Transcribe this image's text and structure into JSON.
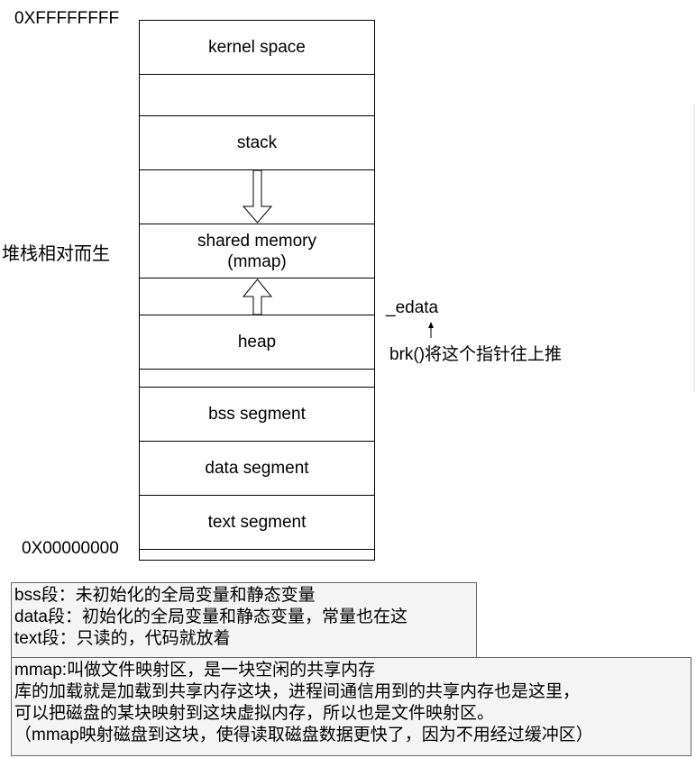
{
  "address_top": "0XFFFFFFFF",
  "address_bottom": "0X00000000",
  "side_label": "堆栈相对而生",
  "segments": {
    "kernel": "kernel space",
    "stack": "stack",
    "shared": "shared memory",
    "shared_sub": "(mmap)",
    "heap": "heap",
    "bss": "bss segment",
    "data": "data segment",
    "text": "text segment"
  },
  "edata_label": "_edata",
  "brk_label": "brk()将这个指针往上推",
  "note1": [
    "bss段：未初始化的全局变量和静态变量",
    "data段：初始化的全局变量和静态变量，常量也在这",
    "text段：只读的，代码就放着"
  ],
  "note2": [
    "mmap:叫做文件映射区，是一块空闲的共享内存",
    "库的加载就是加载到共享内存这块，进程间通信用到的共享内存也是这里，",
    "可以把磁盘的某块映射到这块虚拟内存，所以也是文件映射区。",
    "（mmap映射磁盘到这块，使得读取磁盘数据更快了，因为不用经过缓冲区）"
  ]
}
